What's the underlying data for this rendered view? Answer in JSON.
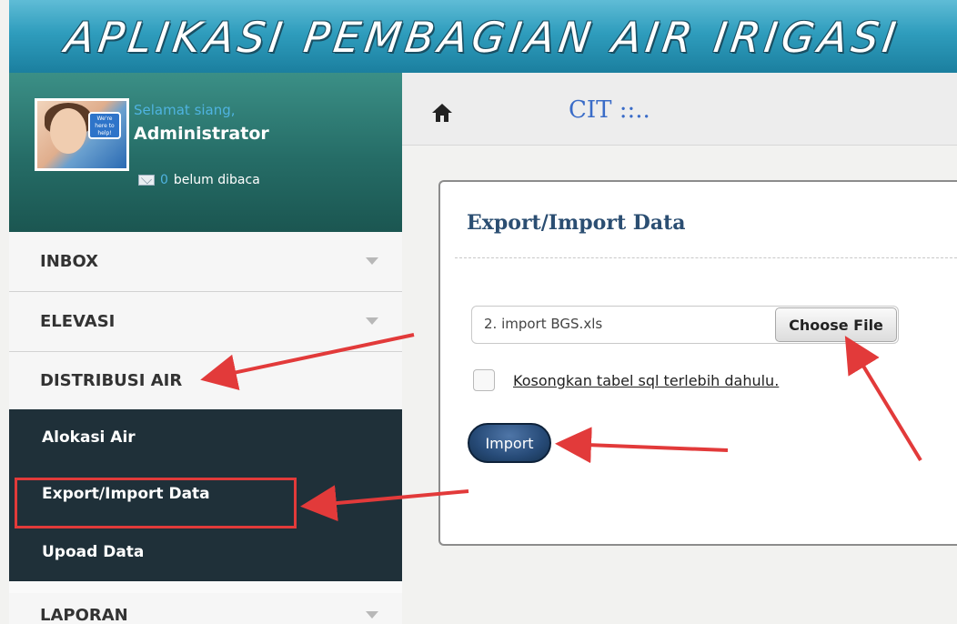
{
  "header": {
    "title": "APLIKASI PEMBAGIAN AIR IRIGASI"
  },
  "profile": {
    "avatar_badge": "We're here to help!",
    "greeting": "Selamat siang,",
    "username": "Administrator",
    "unread_count": "0",
    "unread_label": "belum dibaca"
  },
  "menu": {
    "items": [
      {
        "label": "INBOX"
      },
      {
        "label": "ELEVASI"
      },
      {
        "label": "DISTRIBUSI AIR"
      },
      {
        "label": "LAPORAN"
      }
    ],
    "submenu": [
      {
        "label": "Alokasi Air"
      },
      {
        "label": "Export/Import Data"
      },
      {
        "label": "Upoad Data"
      }
    ]
  },
  "breadcrumb": {
    "text": "CIT ::.."
  },
  "panel": {
    "title": "Export/Import Data",
    "file_name": "2. import BGS.xls",
    "choose_file_label": "Choose File",
    "checkbox_label": "Kosongkan tabel sql terlebih dahulu.",
    "import_label": "Import"
  },
  "colors": {
    "annotation": "#e23a3a",
    "header": "#2f9dbd",
    "sidebar_dark": "#1f3039",
    "profile": "#256c66"
  },
  "icons": [
    "home-icon",
    "mail-icon",
    "chevron-down-icon"
  ]
}
